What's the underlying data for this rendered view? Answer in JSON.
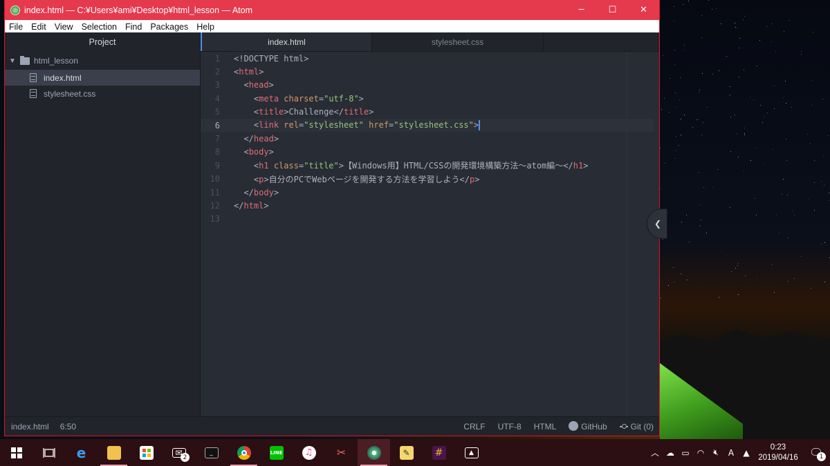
{
  "window": {
    "title": "index.html — C:¥Users¥ami¥Desktop¥html_lesson — Atom",
    "minimize": "─",
    "maximize": "☐",
    "close": "✕"
  },
  "menu": [
    "File",
    "Edit",
    "View",
    "Selection",
    "Find",
    "Packages",
    "Help"
  ],
  "tree": {
    "header": "Project",
    "root": "html_lesson",
    "files": [
      "index.html",
      "stylesheet.css"
    ],
    "selected": "index.html"
  },
  "tabs": [
    "index.html",
    "stylesheet.css"
  ],
  "editor": {
    "current_line": 6,
    "lines": [
      "<!DOCTYPE html>",
      "<html>",
      "  <head>",
      "    <meta charset=\"utf-8\">",
      "    <title>Challenge</title>",
      "    <link rel=\"stylesheet\" href=\"stylesheet.css\">",
      "  </head>",
      "  <body>",
      "    <h1 class=\"title\">【Windows用】HTML/CSSの開発環境構築方法～atom編～</h1>",
      "    <p>自分のPCでWebページを開発する方法を学習しよう</p>",
      "  </body>",
      "</html>",
      ""
    ]
  },
  "status": {
    "file": "index.html",
    "cursor": "6:50",
    "line_ending": "CRLF",
    "encoding": "UTF-8",
    "grammar": "HTML",
    "github": "GitHub",
    "git": "Git (0)"
  },
  "taskbar": {
    "mail_badge": "2",
    "clock_time": "0:23",
    "clock_date": "2019/04/16",
    "notif_badge": "1",
    "ime": "A"
  },
  "colors": {
    "titlebar": "#e5394e",
    "tag": "#e06c75",
    "attr": "#d19a66",
    "string": "#98c379",
    "text": "#abb2bf"
  }
}
